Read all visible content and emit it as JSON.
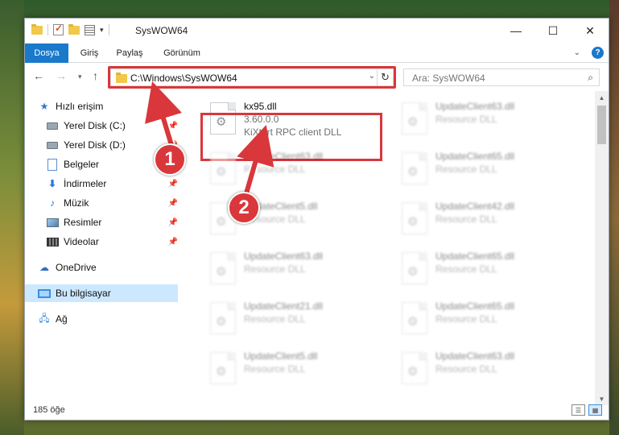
{
  "window": {
    "title": "SysWOW64",
    "minimize_glyph": "—",
    "maximize_glyph": "☐",
    "close_glyph": "✕"
  },
  "ribbon": {
    "tabs": [
      "Dosya",
      "Giriş",
      "Paylaş",
      "Görünüm"
    ],
    "help_glyph": "?",
    "active_tab_color": "#1979ca"
  },
  "navigation": {
    "address": "C:\\Windows\\SysWOW64",
    "search_placeholder": "Ara: SysWOW64"
  },
  "sidebar": {
    "items": [
      {
        "label": "Hızlı erişim",
        "icon": "star-icon"
      },
      {
        "label": "Yerel Disk (C:)",
        "icon": "disk-icon",
        "pinned": true
      },
      {
        "label": "Yerel Disk (D:)",
        "icon": "disk-icon",
        "pinned": true
      },
      {
        "label": "Belgeler",
        "icon": "document-icon",
        "pinned": true
      },
      {
        "label": "İndirmeler",
        "icon": "download-icon",
        "pinned": true
      },
      {
        "label": "Müzik",
        "icon": "music-icon",
        "pinned": true
      },
      {
        "label": "Resimler",
        "icon": "picture-icon",
        "pinned": true
      },
      {
        "label": "Videolar",
        "icon": "video-icon",
        "pinned": true
      },
      {
        "label": "OneDrive",
        "icon": "cloud-icon"
      },
      {
        "label": "Bu bilgisayar",
        "icon": "computer-icon",
        "selected": true
      },
      {
        "label": "Ağ",
        "icon": "network-icon"
      }
    ]
  },
  "files": {
    "highlighted": {
      "name": "kx95.dll",
      "version": "3.60.0.0",
      "description": "KiXtart RPC client DLL"
    },
    "others": [
      {
        "name": "UpdateClient63.dll",
        "description": "Resource DLL"
      },
      {
        "name": "UpdateClient63.dll",
        "description": "Resource DLL"
      },
      {
        "name": "UpdateClient65.dll",
        "description": "Resource DLL"
      },
      {
        "name": "UpdateClient5.dll",
        "description": "Resource DLL"
      },
      {
        "name": "UpdateClient42.dll",
        "description": "Resource DLL"
      },
      {
        "name": "UpdateClient63.dll",
        "description": "Resource DLL"
      },
      {
        "name": "UpdateClient65.dll",
        "description": "Resource DLL"
      },
      {
        "name": "UpdateClient21.dll",
        "description": "Resource DLL"
      },
      {
        "name": "UpdateClient65.dll",
        "description": "Resource DLL"
      },
      {
        "name": "UpdateClient5.dll",
        "description": "Resource DLL"
      },
      {
        "name": "UpdateClient63.dll",
        "description": "Resource DLL"
      }
    ]
  },
  "status": {
    "item_count": "185 öğe"
  },
  "annotations": {
    "step1": "1",
    "step2": "2",
    "highlight_color": "#d9373b"
  }
}
